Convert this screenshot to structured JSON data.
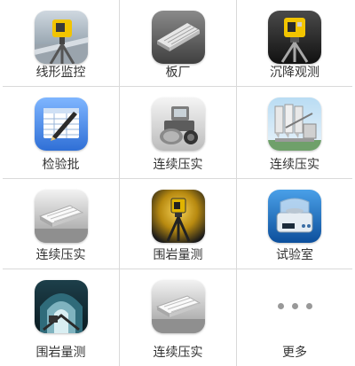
{
  "menu": {
    "items": [
      {
        "label": "线形监控",
        "icon": "total-station-monitor-icon"
      },
      {
        "label": "板厂",
        "icon": "precast-board-icon"
      },
      {
        "label": "沉降观测",
        "icon": "total-station-icon"
      },
      {
        "label": "检验批",
        "icon": "spreadsheet-pen-icon"
      },
      {
        "label": "连续压实",
        "icon": "road-roller-icon"
      },
      {
        "label": "连续压实",
        "icon": "concrete-plant-icon"
      },
      {
        "label": "连续压实",
        "icon": "precast-board-icon"
      },
      {
        "label": "围岩量测",
        "icon": "tunnel-total-station-icon"
      },
      {
        "label": "试验室",
        "icon": "lab-scale-icon"
      },
      {
        "label": "围岩量测",
        "icon": "tunnel-icon"
      },
      {
        "label": "连续压实",
        "icon": "precast-board-icon"
      },
      {
        "label": "更多",
        "icon": "more-dots-icon"
      }
    ]
  },
  "colors": {
    "grid_line": "#d9d9d9",
    "label_text": "#333333",
    "dots": "#999999"
  }
}
